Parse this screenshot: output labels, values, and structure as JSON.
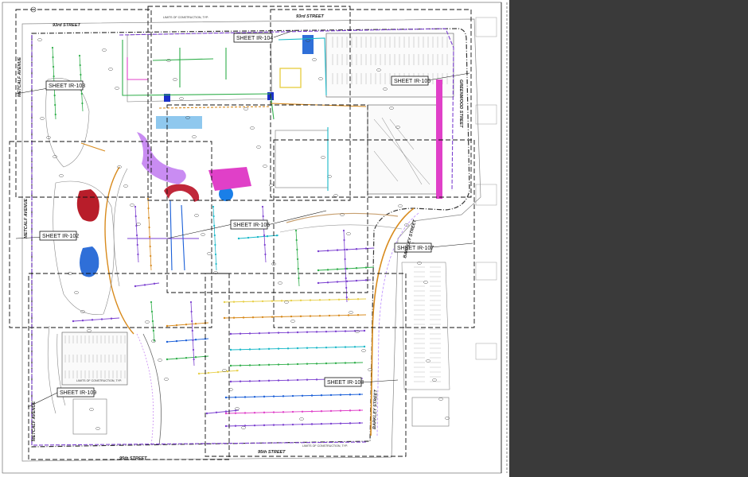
{
  "sheet_callouts": {
    "ir102": "SHEET IR-102",
    "ir103": "SHEET IR-103",
    "ir104": "SHEET IR-104",
    "ir105": "SHEET IR-105",
    "ir106": "SHEET IR-106",
    "ir107": "SHEET IR-107",
    "ir108": "SHEET IR-108",
    "ir109": "SHEET IR-109"
  },
  "streets": {
    "north_left": "93rd STREET",
    "north_right": "93rd STREET",
    "south_left": "95th STREET",
    "south_right": "95th STREET",
    "west_upper": "METCALF AVENUE",
    "west_middle": "METCALF AVENUE",
    "west_lower": "METCALF AVENUE",
    "east_upper": "GREENWOOD STREET",
    "east_middle": "BARKLEY STREET",
    "east_lower": "BARKLEY STREET"
  },
  "notes": {
    "loc_top": "LIMITS OF CONSTRUCTION, TYP.",
    "loc_bottom_left": "LIMITS OF CONSTRUCTION, TYP.",
    "loc_bottom_right": "LIMITS OF CONSTRUCTION, TYP."
  },
  "colors": {
    "paper": "#ffffff",
    "panel": "#3a3a3a",
    "magenta": "#e040c8",
    "purple": "#7b3fd0",
    "green": "#2fae4a",
    "cyan": "#18b8c8",
    "blue": "#1a5fd8",
    "red": "#b81d2a",
    "orange": "#d88a1c",
    "lavender": "#c98cf2"
  }
}
